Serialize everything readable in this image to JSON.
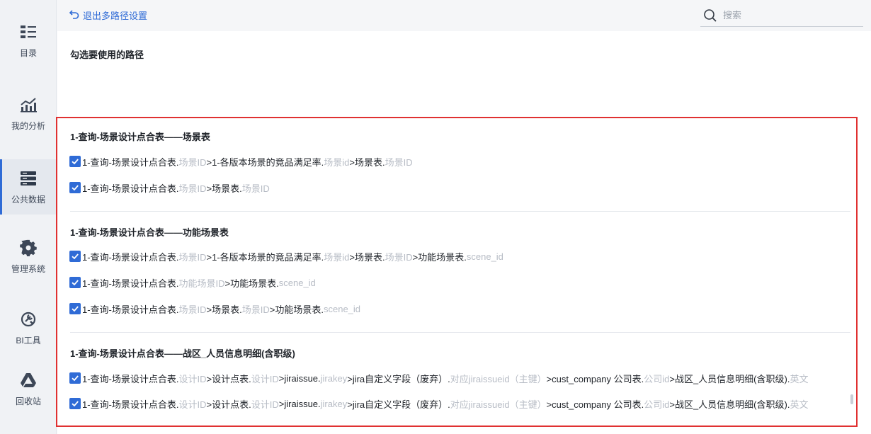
{
  "sidebar": {
    "items": [
      {
        "label": "目录",
        "icon": "catalog-icon"
      },
      {
        "label": "我的分析",
        "icon": "analysis-chart-icon"
      },
      {
        "label": "公共数据",
        "icon": "database-icon",
        "active": true
      },
      {
        "label": "管理系统",
        "icon": "gear-icon"
      },
      {
        "label": "BI工具",
        "icon": "bi-tool-icon"
      },
      {
        "label": "回收站",
        "icon": "recycle-bin-icon"
      }
    ]
  },
  "topbar": {
    "back_label": "退出多路径设置",
    "search_placeholder": "搜索"
  },
  "main": {
    "heading": "勾选要使用的路径",
    "groups": [
      {
        "title": "1-查询-场景设计点合表——场景表",
        "paths": [
          [
            [
              "t",
              "1-查询-场景设计点合表."
            ],
            [
              "m",
              "场景ID"
            ],
            [
              "t",
              ">1-各版本场景的竟品满足率."
            ],
            [
              "m",
              "场景id"
            ],
            [
              "t",
              ">场景表."
            ],
            [
              "m",
              "场景ID"
            ]
          ],
          [
            [
              "t",
              "1-查询-场景设计点合表."
            ],
            [
              "m",
              "场景ID"
            ],
            [
              "t",
              ">场景表."
            ],
            [
              "m",
              "场景ID"
            ]
          ]
        ]
      },
      {
        "title": "1-查询-场景设计点合表——功能场景表",
        "paths": [
          [
            [
              "t",
              "1-查询-场景设计点合表."
            ],
            [
              "m",
              "场景ID"
            ],
            [
              "t",
              ">1-各版本场景的竟品满足率."
            ],
            [
              "m",
              "场景id"
            ],
            [
              "t",
              ">场景表."
            ],
            [
              "m",
              "场景ID"
            ],
            [
              "t",
              ">功能场景表."
            ],
            [
              "m",
              "scene_id"
            ]
          ],
          [
            [
              "t",
              "1-查询-场景设计点合表."
            ],
            [
              "m",
              "功能场景ID"
            ],
            [
              "t",
              ">功能场景表."
            ],
            [
              "m",
              "scene_id"
            ]
          ],
          [
            [
              "t",
              "1-查询-场景设计点合表."
            ],
            [
              "m",
              "场景ID"
            ],
            [
              "t",
              ">场景表."
            ],
            [
              "m",
              "场景ID"
            ],
            [
              "t",
              ">功能场景表."
            ],
            [
              "m",
              "scene_id"
            ]
          ]
        ]
      },
      {
        "title": "1-查询-场景设计点合表——战区_人员信息明细(含职级)",
        "paths": [
          [
            [
              "t",
              "1-查询-场景设计点合表."
            ],
            [
              "m",
              "设计ID"
            ],
            [
              "t",
              ">设计点表."
            ],
            [
              "m",
              "设计ID"
            ],
            [
              "t",
              ">jiraissue."
            ],
            [
              "m",
              "jirakey"
            ],
            [
              "t",
              ">jira自定义字段（废弃）."
            ],
            [
              "m",
              "对应jiraissueid（主键）"
            ],
            [
              "t",
              ">cust_company  公司表."
            ],
            [
              "m",
              "公司id"
            ],
            [
              "t",
              ">战区_人员信息明细(含职级)."
            ],
            [
              "m",
              "英文"
            ]
          ],
          [
            [
              "t",
              "1-查询-场景设计点合表."
            ],
            [
              "m",
              "设计ID"
            ],
            [
              "t",
              ">设计点表."
            ],
            [
              "m",
              "设计ID"
            ],
            [
              "t",
              ">jiraissue."
            ],
            [
              "m",
              "jirakey"
            ],
            [
              "t",
              ">jira自定义字段（废弃）."
            ],
            [
              "m",
              "对应jiraissueid（主键）"
            ],
            [
              "t",
              ">cust_company  公司表."
            ],
            [
              "m",
              "公司id"
            ],
            [
              "t",
              ">战区_人员信息明细(含职级)."
            ],
            [
              "m",
              "英文"
            ]
          ]
        ]
      }
    ]
  },
  "colors": {
    "accent": "#2f6bd6",
    "highlight_border": "#e03131",
    "muted": "#b7bcc5"
  }
}
